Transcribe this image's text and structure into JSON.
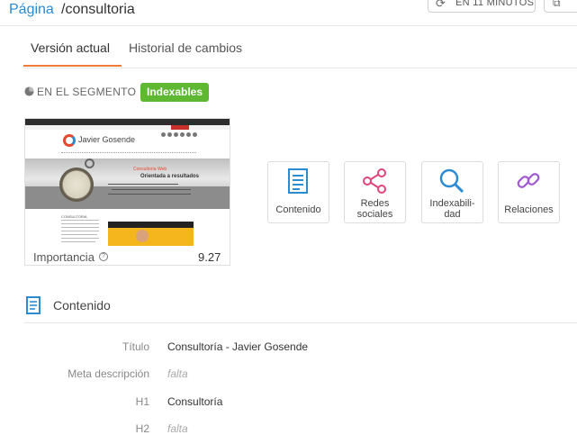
{
  "header": {
    "page_word": "Página",
    "page_path": "/consultoria",
    "refresh_label": "EN 11 MINUTOS"
  },
  "tabs": {
    "current": "Versión actual",
    "history": "Historial de cambios"
  },
  "segment": {
    "label": "EN EL SEGMENTO",
    "badge": "Indexables"
  },
  "thumbnail": {
    "logo_text": "Javier Gosende",
    "hero_title": "Consultoría Web",
    "hero_subtitle": "Orientada a resultados",
    "heading": "CONSULTORIA"
  },
  "importance": {
    "label": "Importancia",
    "help": "?",
    "value": "9.27"
  },
  "cards": [
    {
      "label_1": "Contenido",
      "label_2": "",
      "icon": "document-icon"
    },
    {
      "label_1": "Redes",
      "label_2": "sociales",
      "icon": "share-icon"
    },
    {
      "label_1": "Indexabili-",
      "label_2": "dad",
      "icon": "search-icon"
    },
    {
      "label_1": "Relaciones",
      "label_2": "",
      "icon": "link-icon"
    }
  ],
  "content": {
    "title": "Contenido",
    "rows": [
      {
        "label": "Título",
        "value": "Consultoría - Javier Gosende"
      },
      {
        "label": "Meta descripción",
        "value": "falta"
      },
      {
        "label": "H1",
        "value": "Consultoría"
      },
      {
        "label": "H2",
        "value": "falta"
      }
    ]
  },
  "colors": {
    "accent_blue": "#2b8bd3",
    "tab_underline": "#ee7b3a",
    "badge_green": "#5fb832",
    "share_pink": "#e0467a",
    "link_purple": "#a05ad0"
  }
}
